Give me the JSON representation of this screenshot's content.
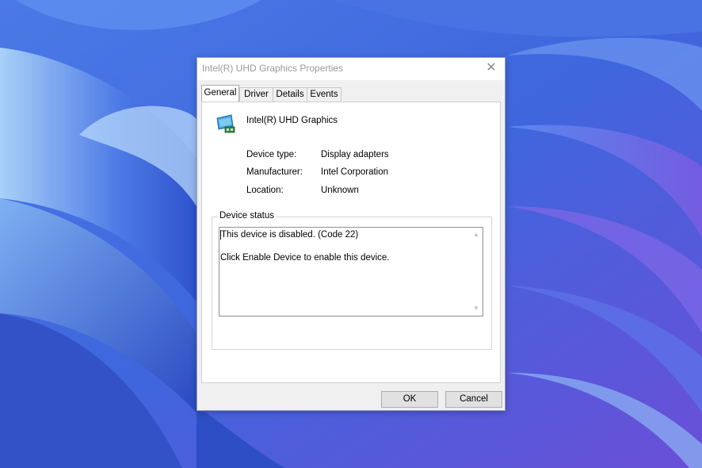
{
  "dialog": {
    "title": "Intel(R) UHD Graphics Properties",
    "close_symbol": "✕",
    "tabs": [
      {
        "label": "General",
        "active": true
      },
      {
        "label": "Driver",
        "active": false
      },
      {
        "label": "Details",
        "active": false
      },
      {
        "label": "Events",
        "active": false
      }
    ],
    "device_icon": "display-adapter-icon",
    "device_name": "Intel(R) UHD Graphics",
    "properties": [
      {
        "label": "Device type:",
        "value": "Display adapters"
      },
      {
        "label": "Manufacturer:",
        "value": "Intel Corporation"
      },
      {
        "label": "Location:",
        "value": "Unknown"
      }
    ],
    "status": {
      "group_title": "Device status",
      "line1": "This device is disabled. (Code 22)",
      "line2": "Click Enable Device to enable this device."
    },
    "buttons": {
      "ok": "OK",
      "cancel": "Cancel"
    }
  },
  "colors": {
    "wallpaper_base": "#3b63d8",
    "wallpaper_light": "#9ec6f5",
    "wallpaper_purple": "#7c5ce0"
  }
}
